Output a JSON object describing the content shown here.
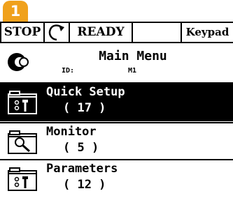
{
  "badge": "1",
  "status_bar": {
    "stop": "STOP",
    "direction_icon": "rotation-arrow-icon",
    "ready": "READY",
    "blank": "",
    "mode": "Keypad"
  },
  "header": {
    "logo_icon": "vacon-logo-icon",
    "title": "Main Menu",
    "id_label": "ID:",
    "id_value": "M1"
  },
  "menu": [
    {
      "label": "Quick Setup",
      "count": "( 17 )",
      "icon": "folder-settings-icon",
      "selected": true
    },
    {
      "label": "Monitor",
      "count": "( 5 )",
      "icon": "folder-magnifier-icon",
      "selected": false
    },
    {
      "label": "Parameters",
      "count": "( 12 )",
      "icon": "folder-settings-icon",
      "selected": false
    }
  ],
  "colors": {
    "accent": "#f0a11c",
    "selection_bg": "#000000",
    "selection_fg": "#ffffff"
  }
}
